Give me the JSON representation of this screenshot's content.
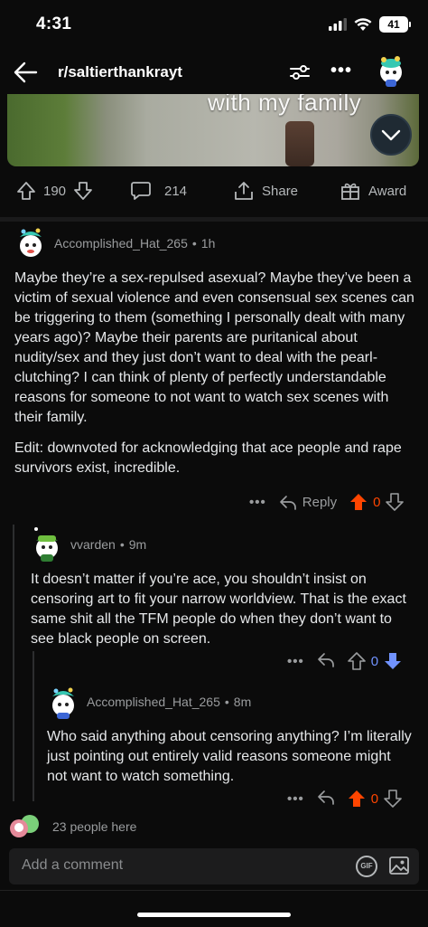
{
  "status_bar": {
    "time": "4:31",
    "battery": "41"
  },
  "nav": {
    "title": "r/saltierthankrayt"
  },
  "post": {
    "media_caption": "with my family"
  },
  "post_actions": {
    "upvotes": "190",
    "comments": "214",
    "share_label": "Share",
    "award_label": "Award"
  },
  "comments": [
    {
      "author": "Accomplished_Hat_265",
      "time": "1h",
      "body": [
        "Maybe they’re a sex-repulsed asexual? Maybe they’ve been a victim of sexual violence and even consensual sex scenes can be triggering to them (something I personally dealt with many years ago)? Maybe their parents are puritanical about nudity/sex and they just don’t want to deal with the pearl-clutching? I can think of plenty of perfectly understandable reasons for someone to not want to watch sex scenes with their family.",
        "Edit: downvoted for acknowledging that ace people and rape survivors exist, incredible."
      ],
      "reply_label": "Reply",
      "score": "0",
      "vote": "up"
    },
    {
      "author": "vvarden",
      "time": "9m",
      "body": [
        "It doesn’t matter if you’re ace, you shouldn’t insist on censoring art to fit your narrow worldview. That is the exact same shit all the TFM people do when they don’t want to see black people on screen."
      ],
      "score": "0",
      "vote": "down"
    },
    {
      "author": "Accomplished_Hat_265",
      "time": "8m",
      "body": [
        "Who said anything about censoring anything? I’m literally just pointing out entirely valid reasons someone might not want to watch something."
      ],
      "score": "0",
      "vote": "up"
    }
  ],
  "presence": {
    "text": "23 people here"
  },
  "composer": {
    "placeholder": "Add a comment",
    "gif_label": "GIF"
  },
  "colors": {
    "upvote": "#ff4500",
    "downvote": "#7193ff",
    "background": "#0b0b0b"
  }
}
